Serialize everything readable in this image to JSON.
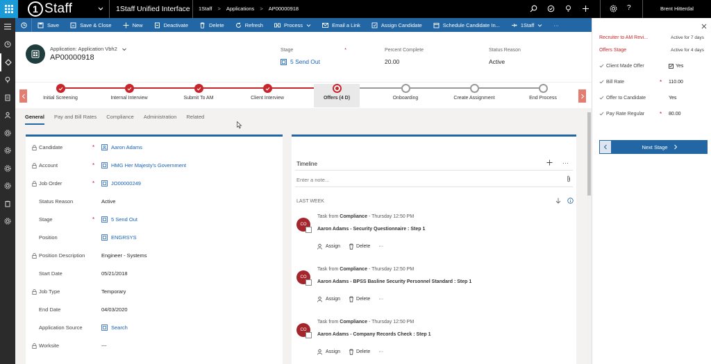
{
  "topbar": {
    "logo_digit": "1",
    "logo_text": "Staff",
    "app_title": "1Staff Unified Interface",
    "breadcrumb": [
      "1Staff",
      "Applications",
      "AP00000918"
    ],
    "user": "Brent Hitterdal"
  },
  "commands": [
    {
      "label": "Save",
      "icon": "save-icon"
    },
    {
      "label": "Save & Close",
      "icon": "save-close-icon"
    },
    {
      "label": "New",
      "icon": "plus-icon"
    },
    {
      "label": "Deactivate",
      "icon": "deactivate-icon"
    },
    {
      "label": "Delete",
      "icon": "trash-icon"
    },
    {
      "label": "Refresh",
      "icon": "refresh-icon"
    },
    {
      "label": "Process",
      "icon": "process-icon"
    },
    {
      "label": "Email a Link",
      "icon": "email-icon"
    },
    {
      "label": "Assign Candidate",
      "icon": "assign-icon"
    },
    {
      "label": "Schedule Candidate In...",
      "icon": "schedule-icon"
    },
    {
      "label": "1Staff",
      "icon": "flow-icon"
    }
  ],
  "header": {
    "entity_type": "Application: Application Vbh2",
    "record_id": "AP00000918",
    "stage_label": "Stage",
    "stage_value": "5 Send Out",
    "percent_label": "Percent Complete",
    "percent_value": "20.00",
    "status_label": "Status Reason",
    "status_value": "Active"
  },
  "process": {
    "stages": [
      {
        "label": "Initial Screening",
        "state": "done"
      },
      {
        "label": "Internal Interview",
        "state": "done"
      },
      {
        "label": "Submit To AM",
        "state": "done"
      },
      {
        "label": "Client Interview",
        "state": "done"
      },
      {
        "label": "Offers  (4 D)",
        "state": "active"
      },
      {
        "label": "Onboarding",
        "state": "future"
      },
      {
        "label": "Create Assignment",
        "state": "future"
      },
      {
        "label": "End Process",
        "state": "future"
      }
    ]
  },
  "tabs": [
    "General",
    "Pay and Bill Rates",
    "Compliance",
    "Administration",
    "Related"
  ],
  "general": {
    "fields": [
      {
        "label": "Candidate",
        "value": "Aaron Adams"
      },
      {
        "label": "Account",
        "value": "HMG Her Majesty's Government"
      },
      {
        "label": "Job Order",
        "value": "JO00000249"
      },
      {
        "label": "Status Reason",
        "value": "Active"
      },
      {
        "label": "Stage",
        "value": "5 Send Out"
      },
      {
        "label": "Position",
        "value": "ENGRSYS"
      },
      {
        "label": "Position Description",
        "value": "Engineer - Systems"
      },
      {
        "label": "Start Date",
        "value": "05/21/2018"
      },
      {
        "label": "Job Type",
        "value": "Temporary"
      },
      {
        "label": "End Date",
        "value": "04/03/2020"
      },
      {
        "label": "Application Source",
        "value": "Search"
      },
      {
        "label": "Worksite",
        "value": "---"
      }
    ]
  },
  "timeline": {
    "title": "Timeline",
    "note_placeholder": "Enter a note...",
    "section": "LAST WEEK",
    "activities": [
      {
        "initials": "CO",
        "prefix": "Task from",
        "owner": "Compliance",
        "time": "- Thursday 12:50 PM",
        "subject": "Aaron Adams - Security Questionnaire : Step 1"
      },
      {
        "initials": "CO",
        "prefix": "Task from",
        "owner": "Compliance",
        "time": "- Thursday 12:50 PM",
        "subject": "Aaron Adams - BPSS Basline Security Personnel Standard : Step 1"
      },
      {
        "initials": "CO",
        "prefix": "Task from",
        "owner": "Compliance",
        "time": "- Thursday 12:50 PM",
        "subject": "Aaron Adams - Company Records Check : Step 1"
      }
    ],
    "assign_label": "Assign",
    "delete_label": "Delete",
    "more_label": "···"
  },
  "flyout": {
    "prev_stage": "Recruiter to AM Revi...",
    "prev_stage_active": "Active for 7 days",
    "current_stage": "Offers Stage",
    "current_stage_active": "Active for 4 days",
    "fields": [
      {
        "label": "Client Made Offer",
        "value": "Yes"
      },
      {
        "label": "Bill Rate",
        "value": "110.00"
      },
      {
        "label": "Offer to Candidate",
        "value": "Yes"
      },
      {
        "label": "Pay Rate Regular",
        "value": "80.00"
      }
    ],
    "next_label": "Next Stage"
  }
}
